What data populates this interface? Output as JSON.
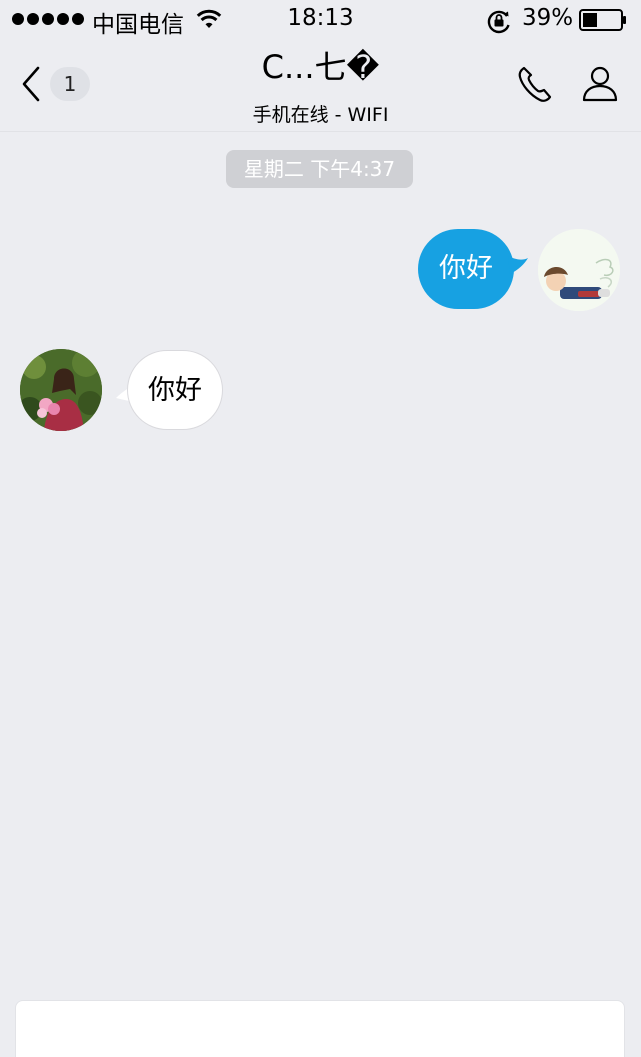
{
  "status_bar": {
    "carrier": "中国电信",
    "time": "18:13",
    "battery_percent": "39%",
    "battery_level": 0.39,
    "signal_bars": 5
  },
  "nav": {
    "unread_count": "1",
    "title": "C...七�",
    "subtitle": "手机在线 - WIFI"
  },
  "chat": {
    "timestamp": "星期二 下午4:37",
    "messages": [
      {
        "sender": "self",
        "text": "你好"
      },
      {
        "sender": "friend",
        "text": "你好"
      }
    ]
  },
  "icons": {
    "back": "chevron-left-icon",
    "phone": "phone-icon",
    "profile": "person-icon",
    "wifi": "wifi-icon",
    "orientation_lock": "lock-rotation-icon",
    "battery": "battery-icon"
  },
  "colors": {
    "background": "#ecedf1",
    "outgoing_bubble": "#17a1e2",
    "incoming_bubble": "#ffffff",
    "timestamp_pill": "#cfd0d4"
  }
}
